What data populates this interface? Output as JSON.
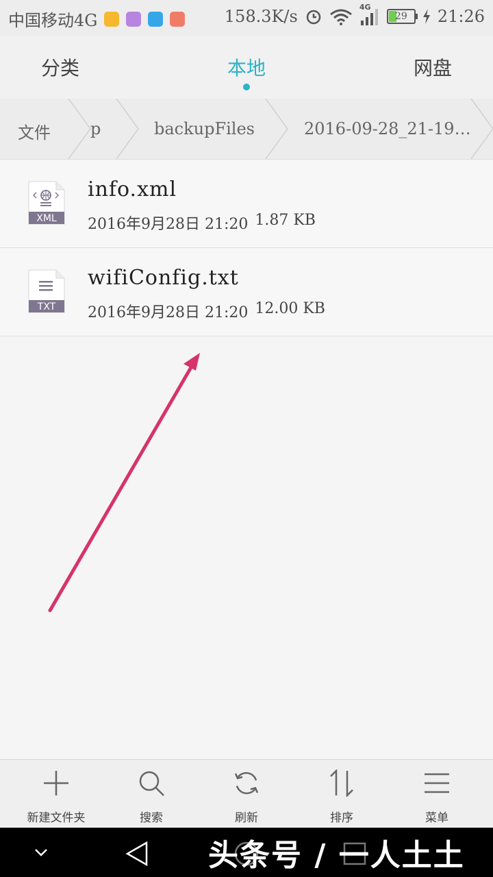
{
  "status_bar": {
    "carrier": "中国移动4G",
    "net_speed": "158.3K/s",
    "signal_type": "4G",
    "battery": "29",
    "time": "21:26",
    "app_icon_colors": [
      "#f5b82e",
      "#b784e0",
      "#35a7e8",
      "#f07c67"
    ]
  },
  "tabs": [
    {
      "label": "分类",
      "active": false
    },
    {
      "label": "本地",
      "active": true
    },
    {
      "label": "网盘",
      "active": false
    }
  ],
  "breadcrumb": [
    "文件",
    "p",
    "backupFiles",
    "2016-09-28_21-19…"
  ],
  "files": [
    {
      "name": "info.xml",
      "date": "2016年9月28日 21:20",
      "size": "1.87 KB",
      "type_label": "XML",
      "icon": "xml-file-icon"
    },
    {
      "name": "wifiConfig.txt",
      "date": "2016年9月28日 21:20",
      "size": "12.00 KB",
      "type_label": "TXT",
      "icon": "txt-file-icon"
    }
  ],
  "actions": [
    {
      "label": "新建文件夹",
      "icon": "plus-icon"
    },
    {
      "label": "搜索",
      "icon": "search-icon"
    },
    {
      "label": "刷新",
      "icon": "refresh-icon"
    },
    {
      "label": "排序",
      "icon": "sort-icon"
    },
    {
      "label": "菜单",
      "icon": "menu-icon"
    }
  ],
  "watermark": "头条号 / 一人土土",
  "colors": {
    "accent": "#2bb3c6",
    "arrow": "#d6336c"
  }
}
